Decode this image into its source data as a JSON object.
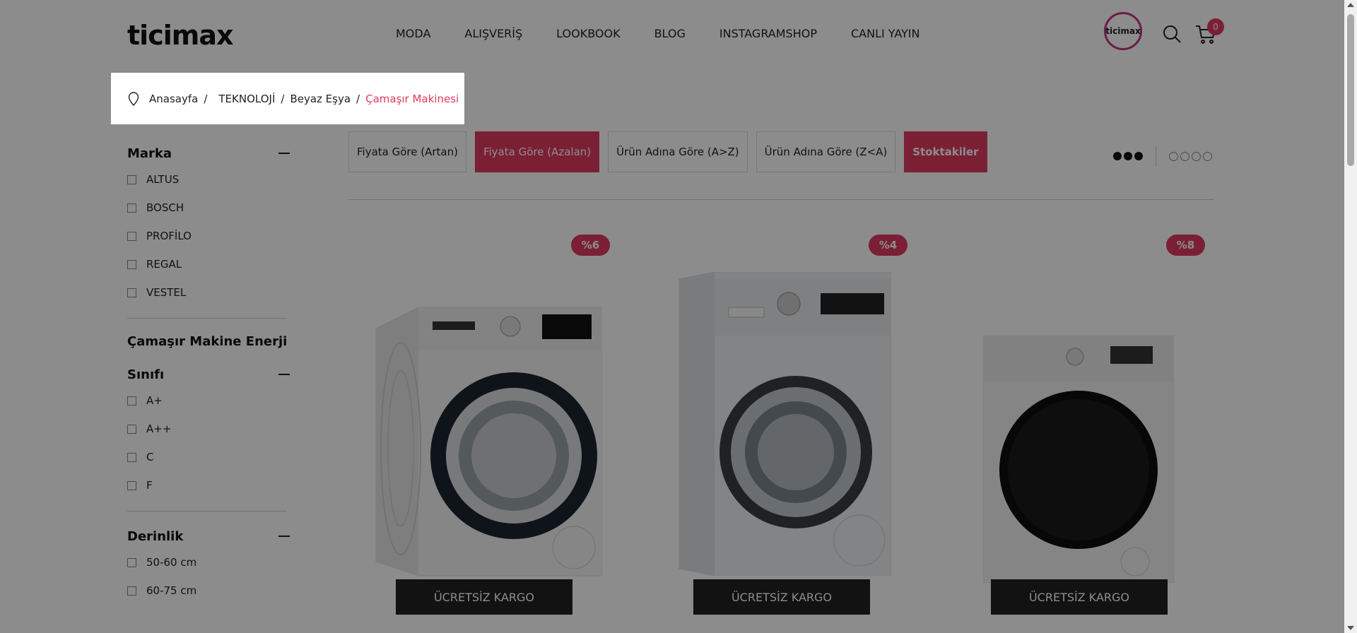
{
  "header": {
    "logo_text": "ticimax",
    "nav": [
      "MODA",
      "ALIŞVERİŞ",
      "LOOKBOOK",
      "BLOG",
      "INSTAGRAMSHOP",
      "CANLI YAYIN"
    ],
    "insta_badge_text": "ticimax",
    "cart_count": "0"
  },
  "breadcrumb": {
    "items": [
      "Anasayfa",
      "TEKNOLOJİ",
      "Beyaz Eşya"
    ],
    "current": "Çamaşır Makinesi",
    "separator": "/"
  },
  "sidebar": {
    "marka": {
      "title": "Marka",
      "options": [
        "ALTUS",
        "BOSCH",
        "PROFİLO",
        "REGAL",
        "VESTEL"
      ]
    },
    "energy": {
      "title_line1": "Çamaşır Makine Enerji",
      "title_line2": "Sınıfı",
      "options": [
        "A+",
        "A++",
        "C",
        "F"
      ]
    },
    "derinlik": {
      "title": "Derinlik",
      "options": [
        "50-60 cm",
        "60-75 cm"
      ]
    }
  },
  "sort": {
    "buttons": [
      "Fiyata Göre (Artan)",
      "Fiyata Göre (Azalan)",
      "Ürün Adına Göre (A>Z)",
      "Ürün Adına Göre (Z<A)",
      "Stoktakiler"
    ],
    "active_index": 1,
    "stock_active": true
  },
  "products": [
    {
      "discount": "%6",
      "kargo": "ÜCRETSİZ KARGO"
    },
    {
      "discount": "%4",
      "kargo": "ÜCRETSİZ KARGO"
    },
    {
      "discount": "%8",
      "kargo": "ÜCRETSİZ KARGO"
    }
  ],
  "colors": {
    "accent": "#e03b5f",
    "dark": "#222222",
    "overlay": "rgba(0,0,0,0.45)"
  }
}
